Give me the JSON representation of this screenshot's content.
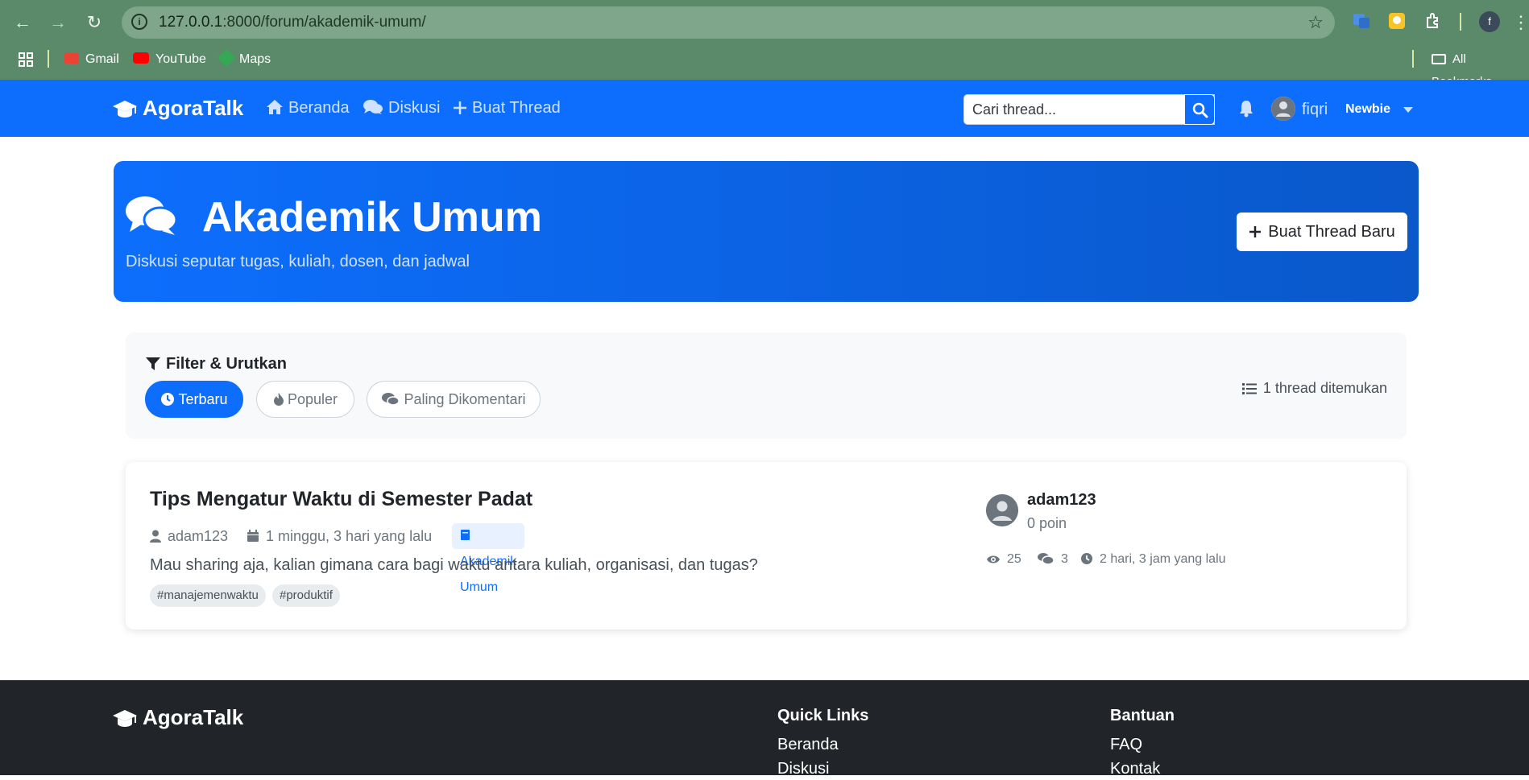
{
  "browser": {
    "url_host": "127.0.0.1",
    "url_rest": ":8000/forum/akademik-umum/",
    "bookmarks": [
      "Gmail",
      "YouTube",
      "Maps"
    ],
    "all_bookmarks_label": "All Bookmarks",
    "profile_initial": "f"
  },
  "navbar": {
    "brand": "AgoraTalk",
    "links": [
      "Beranda",
      "Diskusi",
      "Buat Thread"
    ],
    "search_placeholder": "Cari thread...",
    "username": "fiqri",
    "rank": "Newbie"
  },
  "hero": {
    "title": "Akademik Umum",
    "subtitle": "Diskusi seputar tugas, kuliah, dosen, dan jadwal",
    "button": "Buat Thread Baru"
  },
  "filter": {
    "title": "Filter & Urutkan",
    "options": [
      "Terbaru",
      "Populer",
      "Paling Dikomentari"
    ],
    "active": "Terbaru",
    "count_text": "1 thread ditemukan"
  },
  "threads": [
    {
      "title": "Tips Mengatur Waktu di Semester Padat",
      "author": "adam123",
      "time": "1 minggu, 3 hari yang lalu",
      "category": "Akademik Umum",
      "excerpt": "Mau sharing aja, kalian gimana cara bagi waktu antara kuliah, organisasi, dan tugas?",
      "tags": [
        "#manajemenwaktu",
        "#produktif"
      ],
      "author_points": "0 poin",
      "views": "25",
      "replies": "3",
      "last_activity": "2 hari, 3 jam yang lalu"
    }
  ],
  "footer": {
    "brand": "AgoraTalk",
    "quick_links_title": "Quick Links",
    "quick_links": [
      "Beranda",
      "Diskusi"
    ],
    "help_title": "Bantuan",
    "help_links": [
      "FAQ",
      "Kontak"
    ]
  },
  "colors": {
    "primary": "#0d6efd",
    "chrome": "#5b8a6a",
    "footer": "#212529"
  }
}
